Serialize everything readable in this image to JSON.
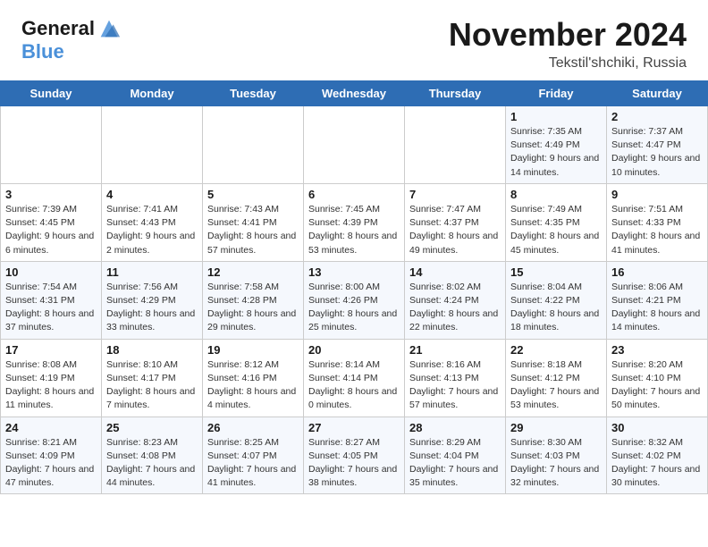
{
  "header": {
    "logo_line1": "General",
    "logo_line2": "Blue",
    "month_title": "November 2024",
    "location": "Tekstil'shchiki, Russia"
  },
  "weekdays": [
    "Sunday",
    "Monday",
    "Tuesday",
    "Wednesday",
    "Thursday",
    "Friday",
    "Saturday"
  ],
  "weeks": [
    [
      {
        "day": "",
        "info": ""
      },
      {
        "day": "",
        "info": ""
      },
      {
        "day": "",
        "info": ""
      },
      {
        "day": "",
        "info": ""
      },
      {
        "day": "",
        "info": ""
      },
      {
        "day": "1",
        "info": "Sunrise: 7:35 AM\nSunset: 4:49 PM\nDaylight: 9 hours and 14 minutes."
      },
      {
        "day": "2",
        "info": "Sunrise: 7:37 AM\nSunset: 4:47 PM\nDaylight: 9 hours and 10 minutes."
      }
    ],
    [
      {
        "day": "3",
        "info": "Sunrise: 7:39 AM\nSunset: 4:45 PM\nDaylight: 9 hours and 6 minutes."
      },
      {
        "day": "4",
        "info": "Sunrise: 7:41 AM\nSunset: 4:43 PM\nDaylight: 9 hours and 2 minutes."
      },
      {
        "day": "5",
        "info": "Sunrise: 7:43 AM\nSunset: 4:41 PM\nDaylight: 8 hours and 57 minutes."
      },
      {
        "day": "6",
        "info": "Sunrise: 7:45 AM\nSunset: 4:39 PM\nDaylight: 8 hours and 53 minutes."
      },
      {
        "day": "7",
        "info": "Sunrise: 7:47 AM\nSunset: 4:37 PM\nDaylight: 8 hours and 49 minutes."
      },
      {
        "day": "8",
        "info": "Sunrise: 7:49 AM\nSunset: 4:35 PM\nDaylight: 8 hours and 45 minutes."
      },
      {
        "day": "9",
        "info": "Sunrise: 7:51 AM\nSunset: 4:33 PM\nDaylight: 8 hours and 41 minutes."
      }
    ],
    [
      {
        "day": "10",
        "info": "Sunrise: 7:54 AM\nSunset: 4:31 PM\nDaylight: 8 hours and 37 minutes."
      },
      {
        "day": "11",
        "info": "Sunrise: 7:56 AM\nSunset: 4:29 PM\nDaylight: 8 hours and 33 minutes."
      },
      {
        "day": "12",
        "info": "Sunrise: 7:58 AM\nSunset: 4:28 PM\nDaylight: 8 hours and 29 minutes."
      },
      {
        "day": "13",
        "info": "Sunrise: 8:00 AM\nSunset: 4:26 PM\nDaylight: 8 hours and 25 minutes."
      },
      {
        "day": "14",
        "info": "Sunrise: 8:02 AM\nSunset: 4:24 PM\nDaylight: 8 hours and 22 minutes."
      },
      {
        "day": "15",
        "info": "Sunrise: 8:04 AM\nSunset: 4:22 PM\nDaylight: 8 hours and 18 minutes."
      },
      {
        "day": "16",
        "info": "Sunrise: 8:06 AM\nSunset: 4:21 PM\nDaylight: 8 hours and 14 minutes."
      }
    ],
    [
      {
        "day": "17",
        "info": "Sunrise: 8:08 AM\nSunset: 4:19 PM\nDaylight: 8 hours and 11 minutes."
      },
      {
        "day": "18",
        "info": "Sunrise: 8:10 AM\nSunset: 4:17 PM\nDaylight: 8 hours and 7 minutes."
      },
      {
        "day": "19",
        "info": "Sunrise: 8:12 AM\nSunset: 4:16 PM\nDaylight: 8 hours and 4 minutes."
      },
      {
        "day": "20",
        "info": "Sunrise: 8:14 AM\nSunset: 4:14 PM\nDaylight: 8 hours and 0 minutes."
      },
      {
        "day": "21",
        "info": "Sunrise: 8:16 AM\nSunset: 4:13 PM\nDaylight: 7 hours and 57 minutes."
      },
      {
        "day": "22",
        "info": "Sunrise: 8:18 AM\nSunset: 4:12 PM\nDaylight: 7 hours and 53 minutes."
      },
      {
        "day": "23",
        "info": "Sunrise: 8:20 AM\nSunset: 4:10 PM\nDaylight: 7 hours and 50 minutes."
      }
    ],
    [
      {
        "day": "24",
        "info": "Sunrise: 8:21 AM\nSunset: 4:09 PM\nDaylight: 7 hours and 47 minutes."
      },
      {
        "day": "25",
        "info": "Sunrise: 8:23 AM\nSunset: 4:08 PM\nDaylight: 7 hours and 44 minutes."
      },
      {
        "day": "26",
        "info": "Sunrise: 8:25 AM\nSunset: 4:07 PM\nDaylight: 7 hours and 41 minutes."
      },
      {
        "day": "27",
        "info": "Sunrise: 8:27 AM\nSunset: 4:05 PM\nDaylight: 7 hours and 38 minutes."
      },
      {
        "day": "28",
        "info": "Sunrise: 8:29 AM\nSunset: 4:04 PM\nDaylight: 7 hours and 35 minutes."
      },
      {
        "day": "29",
        "info": "Sunrise: 8:30 AM\nSunset: 4:03 PM\nDaylight: 7 hours and 32 minutes."
      },
      {
        "day": "30",
        "info": "Sunrise: 8:32 AM\nSunset: 4:02 PM\nDaylight: 7 hours and 30 minutes."
      }
    ]
  ]
}
